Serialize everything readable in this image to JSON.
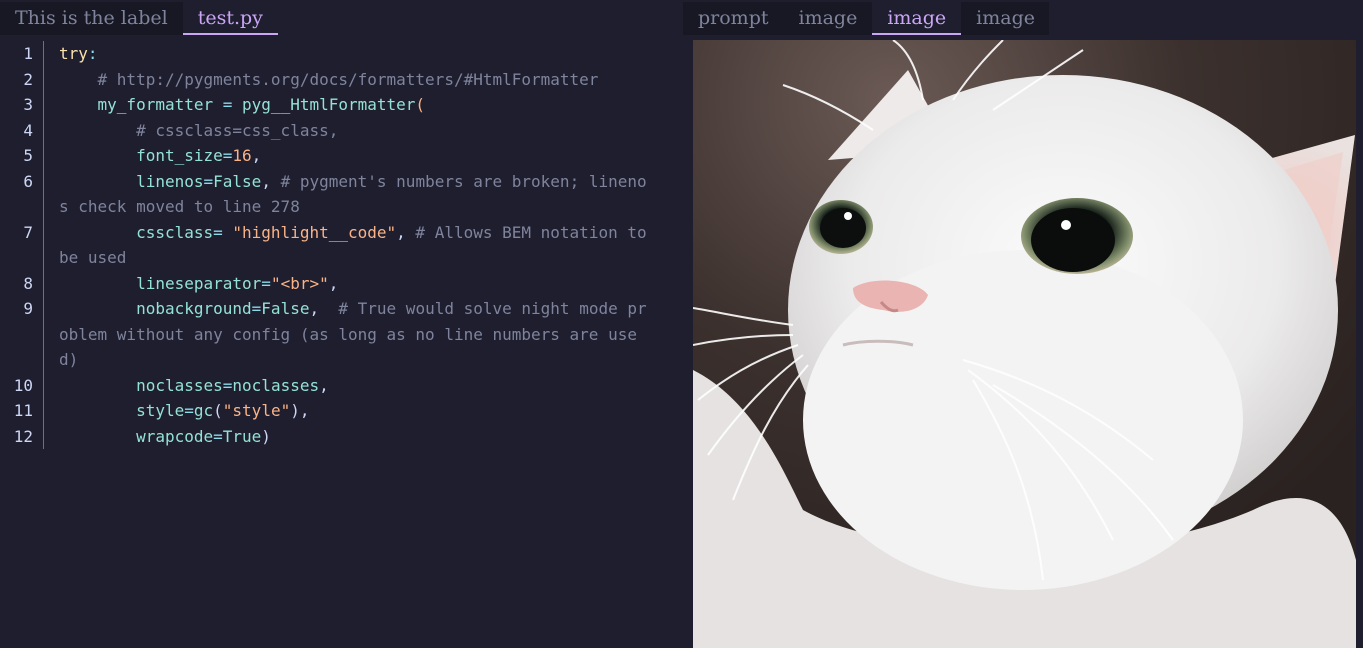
{
  "left_tabs": [
    {
      "label": "This is the label",
      "active": false
    },
    {
      "label": "test.py",
      "active": true
    }
  ],
  "right_tabs": [
    {
      "label": "prompt",
      "active": false
    },
    {
      "label": "image",
      "active": false
    },
    {
      "label": "image",
      "active": true
    },
    {
      "label": "image",
      "active": false
    }
  ],
  "line_numbers": [
    "1",
    "2",
    "3",
    "4",
    "5",
    "6",
    "7",
    "8",
    "9",
    "10",
    "11",
    "12"
  ],
  "code": {
    "l1": {
      "kw": "try",
      "colon": ":"
    },
    "l2": {
      "indent": "    ",
      "comment": "# http://pygments.org/docs/formatters/#HtmlFormatter"
    },
    "l3": {
      "indent": "    ",
      "name": "my_formatter",
      "eq": " = ",
      "call": "pyg__HtmlFormatter",
      "paren": "("
    },
    "l4": {
      "indent": "        ",
      "comment": "# cssclass=css_class,"
    },
    "l5": {
      "indent": "        ",
      "name": "font_size",
      "eq": "=",
      "value": "16",
      "tail": ","
    },
    "l6": {
      "indent": "        ",
      "name": "linenos",
      "eq": "=",
      "value": "False",
      "tail": ", ",
      "comment": "# pygment's numbers are broken; linenos check moved to line 278"
    },
    "l7": {
      "indent": "        ",
      "name": "cssclass",
      "eq": "= ",
      "value": "\"highlight__code\"",
      "tail": ", ",
      "comment": "# Allows BEM notation to be used"
    },
    "l8": {
      "indent": "        ",
      "name": "lineseparator",
      "eq": "=",
      "value": "\"<br>\"",
      "tail": ","
    },
    "l9": {
      "indent": "        ",
      "name": "nobackground",
      "eq": "=",
      "value": "False",
      "tail": ",  ",
      "comment": "# True would solve night mode problem without any config (as long as no line numbers are used)"
    },
    "l10": {
      "indent": "        ",
      "name": "noclasses",
      "eq": "=",
      "value": "noclasses",
      "tail": ","
    },
    "l11": {
      "indent": "        ",
      "name": "style",
      "eq": "=",
      "call": "gc",
      "open": "(",
      "value": "\"style\"",
      "close": "),"
    },
    "l12": {
      "indent": "        ",
      "name": "wrapcode",
      "eq": "=",
      "value": "True",
      "close": ")"
    }
  },
  "colors": {
    "background": "#1e1e2e",
    "tab_bar": "#181825",
    "accent": "#cba6f7",
    "comment": "#7f849c",
    "name": "#94e2d5",
    "string": "#fab387",
    "keyword": "#f9e2af"
  }
}
